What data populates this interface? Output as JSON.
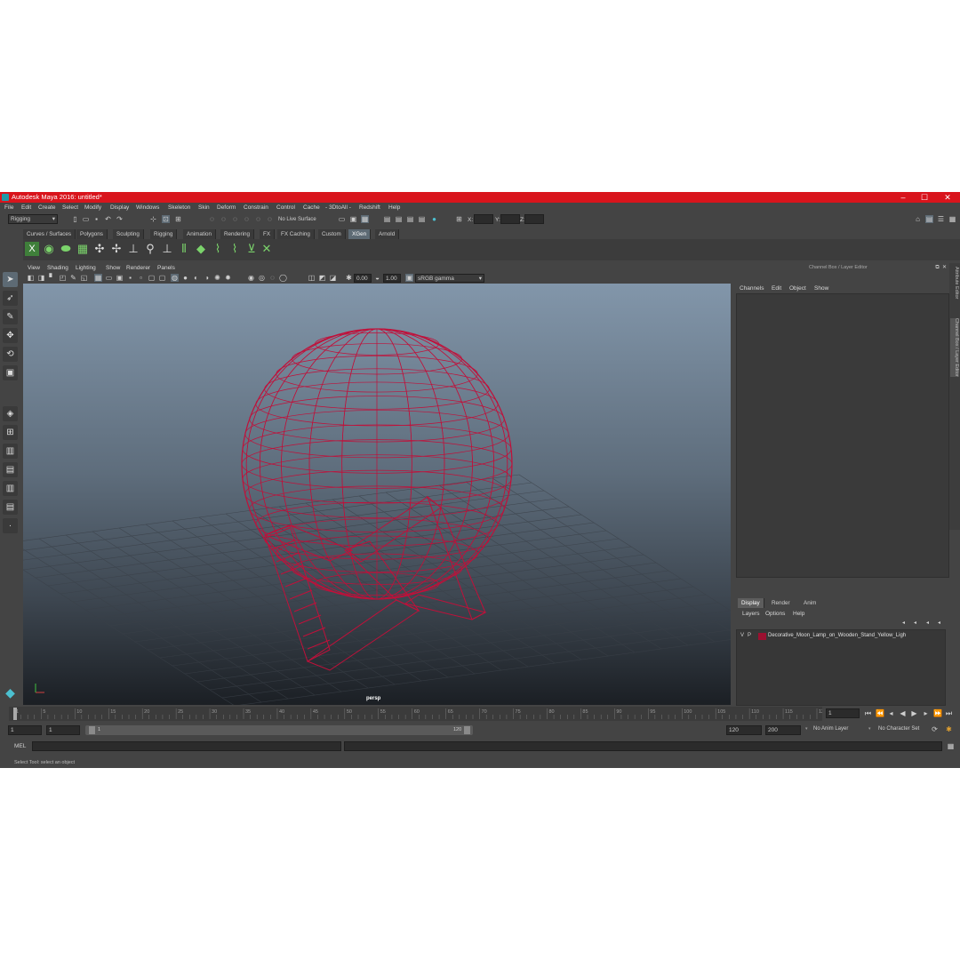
{
  "window": {
    "title": "Autodesk Maya 2016: untitled*",
    "minimize": "–",
    "maximize": "☐",
    "close": "✕"
  },
  "menubar": [
    "File",
    "Edit",
    "Create",
    "Select",
    "Modify",
    "Display",
    "Windows",
    "Skeleton",
    "Skin",
    "Deform",
    "Constrain",
    "Control",
    "Cache",
    "- 3DtoAll -",
    "Redshift",
    "Help"
  ],
  "status": {
    "menuset": "Rigging",
    "live_surface": "No Live Surface",
    "x_label": "X:",
    "y_label": "Y:",
    "z_label": "Z:"
  },
  "shelf_tabs": [
    "Curves / Surfaces",
    "Polygons",
    "Sculpting",
    "Rigging",
    "Animation",
    "Rendering",
    "FX",
    "FX Caching",
    "Custom",
    "XGen",
    "Arnold"
  ],
  "shelf_active": "XGen",
  "viewport": {
    "menu": [
      "View",
      "Shading",
      "Lighting",
      "Show",
      "Renderer",
      "Panels"
    ],
    "exposure": "0.00",
    "gamma": "1.00",
    "color_space": "sRGB gamma",
    "camera_label": "persp"
  },
  "channel_box": {
    "title": "Channel Box / Layer Editor",
    "menu": [
      "Channels",
      "Edit",
      "Object",
      "Show"
    ]
  },
  "layer_editor": {
    "tabs": [
      "Display",
      "Render",
      "Anim"
    ],
    "active_tab": "Display",
    "menu": [
      "Layers",
      "Options",
      "Help"
    ],
    "layers": [
      {
        "visible": "V",
        "playback": "P",
        "color": "#9b1030",
        "name": "Decorative_Moon_Lamp_on_Wooden_Stand_Yellow_Ligh"
      }
    ]
  },
  "side_tabs": [
    "Attribute Editor",
    "Channel Box / Layer Editor"
  ],
  "timeline": {
    "ticks": [
      "1",
      "5",
      "10",
      "15",
      "20",
      "25",
      "30",
      "35",
      "40",
      "45",
      "50",
      "55",
      "60",
      "65",
      "70",
      "75",
      "80",
      "85",
      "90",
      "95",
      "100",
      "105",
      "110",
      "115",
      "120"
    ],
    "current_frame": "1"
  },
  "range": {
    "start": "1",
    "playback_start": "1",
    "slider_start": "1",
    "slider_end": "120",
    "playback_end": "120",
    "end": "200",
    "anim_layer": "No Anim Layer",
    "character_set": "No Character Set"
  },
  "command_line": {
    "label": "MEL"
  },
  "help_line": "Select Tool: select an object",
  "colors": {
    "title_bar": "#d9141c",
    "wireframe": "#c0103a",
    "active_tab": "#5d6a74"
  }
}
